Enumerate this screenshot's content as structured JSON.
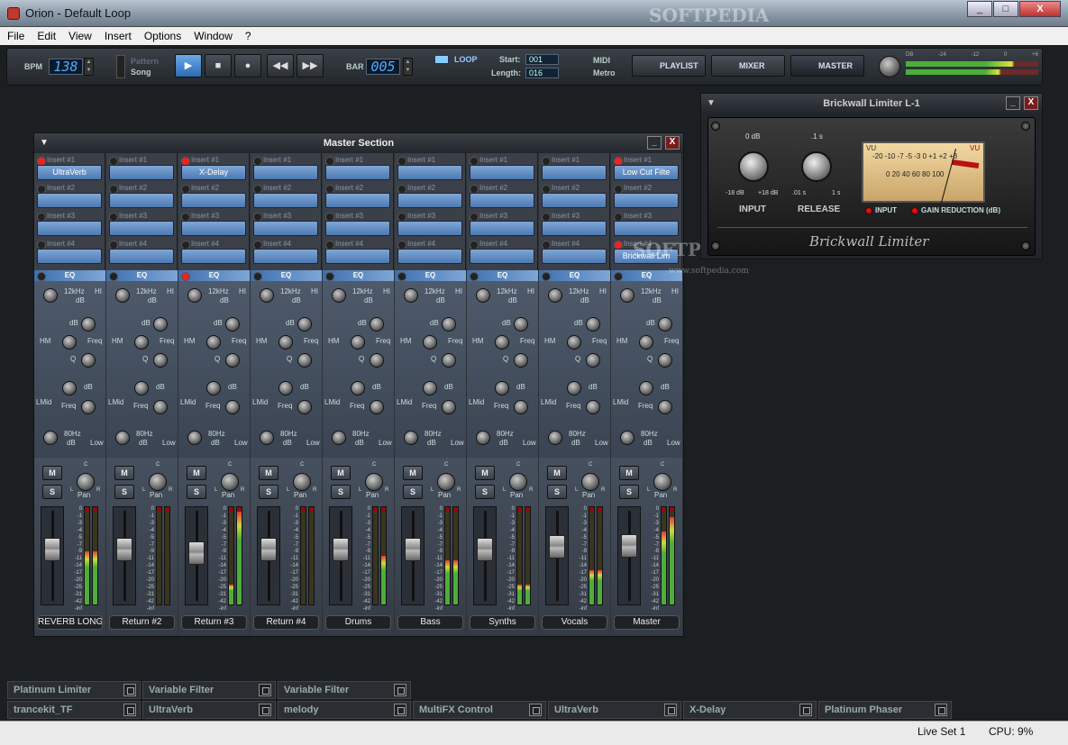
{
  "window": {
    "title": "Orion - Default Loop",
    "min": "_",
    "max": "□",
    "close": "X"
  },
  "menu": [
    "File",
    "Edit",
    "View",
    "Insert",
    "Options",
    "Window",
    "?"
  ],
  "toolbar": {
    "bpm_label": "BPM",
    "bpm": "138",
    "pattern_label": "Pattern",
    "song_label": "Song",
    "bar_label": "BAR",
    "bar": "005",
    "loop_label": "LOOP",
    "start_label": "Start:",
    "start": "001",
    "length_label": "Length:",
    "length": "016",
    "midi_label": "MIDI",
    "metro_label": "Metro",
    "playlist": "PLAYLIST",
    "mixer": "MIXER",
    "master": "MASTER",
    "meter_scale": [
      "DB",
      "-24",
      "-12",
      "0",
      "+6"
    ]
  },
  "master_section": {
    "title": "Master Section",
    "min": "_",
    "close": "X"
  },
  "insert_labels": [
    "Insert #1",
    "Insert #2",
    "Insert #3",
    "Insert #4"
  ],
  "eq": {
    "label": "EQ",
    "hi_freq": "12kHz",
    "hi": "HI",
    "db": "dB",
    "hm": "HM",
    "freq": "Freq",
    "q": "Q",
    "lmid": "LMid",
    "low_freq": "80Hz",
    "low": "Low"
  },
  "channel": {
    "mute": "M",
    "solo": "S",
    "pan": "Pan",
    "l": "L",
    "r": "R",
    "c": "C"
  },
  "db_scale": [
    "0",
    "-1",
    "-3",
    "-4",
    "-5",
    "-7",
    "-9",
    "-11",
    "-14",
    "-17",
    "-20",
    "-25",
    "-31",
    "-42",
    "-inf"
  ],
  "strips": [
    {
      "name": "REVERB LONG",
      "inserts": [
        "UltraVerb",
        "",
        "",
        ""
      ],
      "fader": 0.62,
      "meter": [
        0.55,
        0.55
      ]
    },
    {
      "name": "Return #2",
      "inserts": [
        "",
        "",
        "",
        ""
      ],
      "fader": 0.62,
      "meter": [
        0.0,
        0.0
      ]
    },
    {
      "name": "Return #3",
      "inserts": [
        "X-Delay",
        "",
        "",
        ""
      ],
      "fader": 0.58,
      "meter": [
        0.2,
        0.95
      ]
    },
    {
      "name": "Return #4",
      "inserts": [
        "",
        "",
        "",
        ""
      ],
      "fader": 0.62,
      "meter": [
        0.0,
        0.0
      ]
    },
    {
      "name": "Drums",
      "inserts": [
        "",
        "",
        "",
        ""
      ],
      "fader": 0.62,
      "meter": [
        0.0,
        0.5
      ]
    },
    {
      "name": "Bass",
      "inserts": [
        "",
        "",
        "",
        ""
      ],
      "fader": 0.62,
      "meter": [
        0.45,
        0.45
      ]
    },
    {
      "name": "Synths",
      "inserts": [
        "",
        "",
        "",
        ""
      ],
      "fader": 0.62,
      "meter": [
        0.2,
        0.2
      ]
    },
    {
      "name": "Vocals",
      "inserts": [
        "",
        "",
        "",
        ""
      ],
      "fader": 0.66,
      "meter": [
        0.35,
        0.35
      ]
    },
    {
      "name": "Master",
      "inserts": [
        "Low Cut Filte",
        "",
        "",
        "Brickwall Lim"
      ],
      "fader": 0.68,
      "meter": [
        0.75,
        0.9
      ]
    }
  ],
  "limiter": {
    "title": "Brickwall Limiter L-1",
    "min": "_",
    "close": "X",
    "input_top": "0 dB",
    "input_min": "-18 dB",
    "input_max": "+18 dB",
    "input_label": "INPUT",
    "release_top": ".1 s",
    "release_min": ".01 s",
    "release_max": "1 s",
    "release_label": "RELEASE",
    "vu_left": "VU",
    "vu_right": "VU",
    "vu_top_scale": "-20 -10 -7 -5 -3 0 +1 +2 +3",
    "vu_bottom_scale": "0 20 40 60 80 100",
    "lamp_input": "INPUT",
    "lamp_gr": "GAIN REDUCTION (dB)",
    "logo": "Brickwall Limiter"
  },
  "trays": [
    {
      "label": "Platinum Limiter",
      "row": 1
    },
    {
      "label": "Variable Filter",
      "row": 1
    },
    {
      "label": "Variable Filter",
      "row": 1
    },
    {
      "label": "trancekit_TF",
      "row": 2
    },
    {
      "label": "UltraVerb",
      "row": 2
    },
    {
      "label": "melody",
      "row": 2
    },
    {
      "label": "MultiFX Control",
      "row": 2
    },
    {
      "label": "UltraVerb",
      "row": 2
    },
    {
      "label": "X-Delay",
      "row": 2
    },
    {
      "label": "Platinum Phaser",
      "row": 2
    }
  ],
  "status": {
    "liveset": "Live Set 1",
    "cpu": "CPU: 9%"
  },
  "watermark": {
    "top": "SOFTPEDIA",
    "mid": "SOFTPEDIA",
    "url": "www.softpedia.com"
  }
}
